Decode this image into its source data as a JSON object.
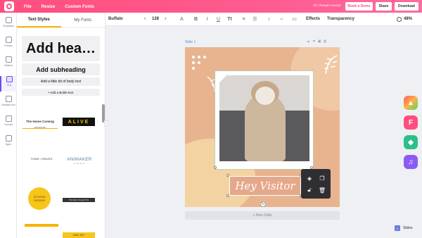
{
  "topbar": {
    "menu": [
      "File",
      "Resize",
      "Custom Fonts"
    ],
    "saved_status": "All Changes Saved",
    "book_demo": "Book a Demo",
    "share": "Share",
    "download": "Download"
  },
  "rail": {
    "items": [
      "Templates",
      "Photos",
      "Objects",
      "Text",
      "Background",
      "Upload",
      "Apps"
    ],
    "active": "Text"
  },
  "panel": {
    "tabs": [
      "Text Styles",
      "My Fonts"
    ],
    "heading": "Add hea…",
    "subheading": "Add subheading",
    "body": "Add a little bit of body text",
    "bullet": "•  Add a Bullet text",
    "templates": {
      "t1": "The Home Coming",
      "t1_sub": "ANNIVERSARY",
      "t2": "ALIVE",
      "t3": "THINK | CREATE",
      "t4": "ANIMAKER",
      "t4_sub": "VIDEO",
      "t5": "SYSTEM DESIGN",
      "t6": "THE NEW COLLECTION",
      "t8": "JUST JOY"
    }
  },
  "toolbar": {
    "font": "Buffalo",
    "size": "128",
    "effects": "Effects",
    "transparency": "Transparency",
    "zoom": "48%"
  },
  "canvas": {
    "slide_label": "Slide 1",
    "name_text": "Hey Visitor",
    "new_slide": "+ New Slide"
  },
  "footer": {
    "slides": "Slides",
    "slides_count": "1"
  },
  "colors": {
    "brand_pink": "#ff4e7e",
    "slide_bg": "#e8b48f",
    "accent_yellow": "#f5b400"
  }
}
